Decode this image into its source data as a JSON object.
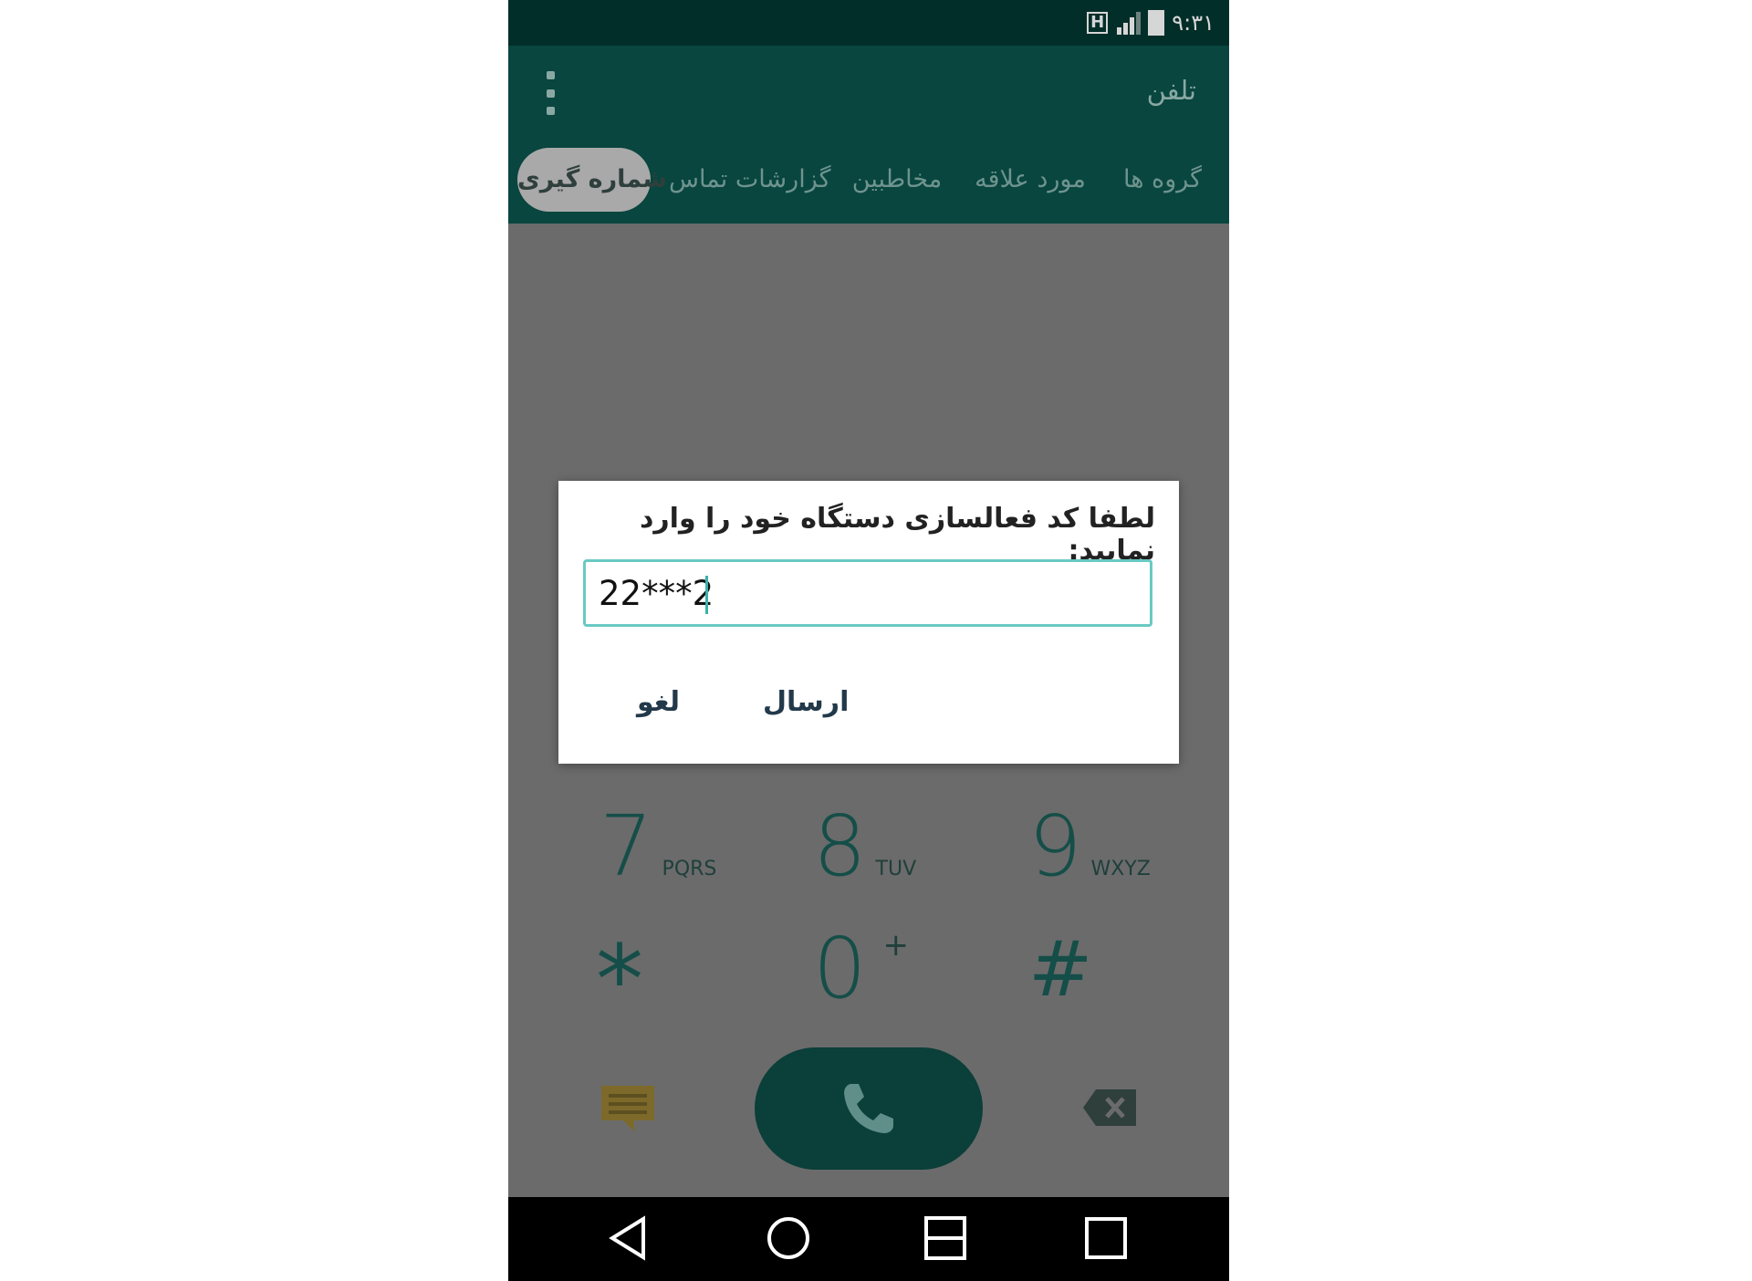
{
  "status_bar": {
    "time": "۹:۳۱",
    "network_label": "H"
  },
  "header": {
    "title": "تلفن"
  },
  "tabs": [
    {
      "label": "شماره گیری",
      "active": true
    },
    {
      "label": "گزارشات تماس",
      "active": false
    },
    {
      "label": "مخاطبین",
      "active": false
    },
    {
      "label": "مورد علاقه",
      "active": false
    },
    {
      "label": "گروه ها",
      "active": false
    }
  ],
  "keypad": {
    "keys": [
      {
        "digit": "7",
        "letters": "PQRS"
      },
      {
        "digit": "8",
        "letters": "TUV"
      },
      {
        "digit": "9",
        "letters": "WXYZ"
      },
      {
        "digit": "*",
        "letters": ""
      },
      {
        "digit": "0",
        "letters": "+"
      },
      {
        "digit": "#",
        "letters": ""
      }
    ]
  },
  "dialog": {
    "message": "لطفا کد فعالسازی دستگاه خود را وارد نمایید:",
    "input_value": "22***2",
    "send_label": "ارسال",
    "cancel_label": "لغو"
  },
  "colors": {
    "header_bg": "#08463f",
    "status_bg": "#022e29",
    "accent": "#69c9c3",
    "call_button": "#0b3f39"
  }
}
